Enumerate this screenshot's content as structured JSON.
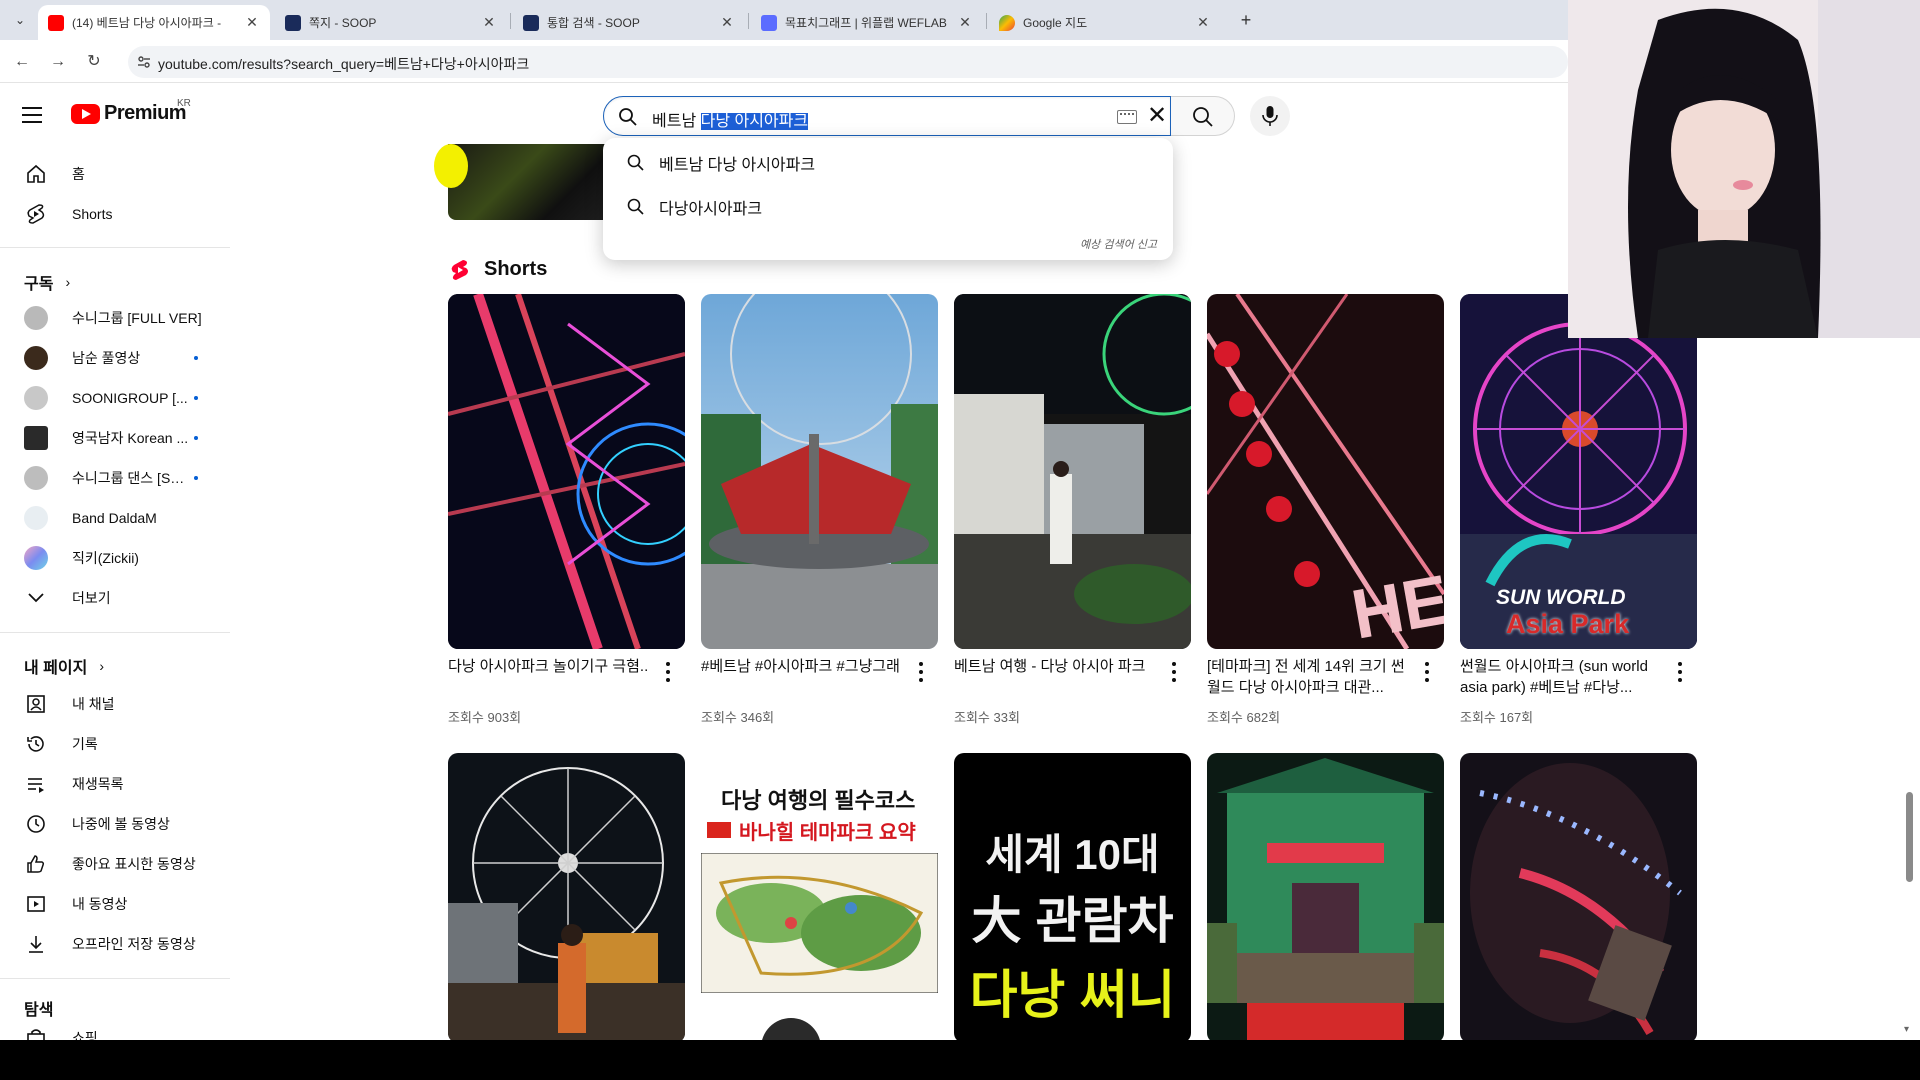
{
  "browser": {
    "tabs": [
      {
        "title": "(14) 베트남 다낭 아시아파크 -",
        "favicon_color": "#ff0000",
        "active": true
      },
      {
        "title": "쪽지 - SOOP",
        "favicon_color": "#1a2b5a",
        "active": false
      },
      {
        "title": "통합 검색 - SOOP",
        "favicon_color": "#1a2b5a",
        "active": false
      },
      {
        "title": "목표치그래프 | 위플랩 WEFLAB",
        "favicon_color": "#5b6cff",
        "active": false
      },
      {
        "title": "Google 지도",
        "favicon_color": "#34a853",
        "active": false
      }
    ],
    "new_tab": "+",
    "url": "youtube.com/results?search_query=베트남+다낭+아시아파크"
  },
  "youtube": {
    "logo_text": "Premium",
    "region": "KR",
    "search": {
      "query_prefix": "베트남 ",
      "query_selected": "다낭 아시아파크",
      "clear": "✕"
    },
    "suggestions": [
      {
        "text": "베트남 다낭 아시아파크"
      },
      {
        "text": "다낭아시아파크"
      }
    ],
    "suggestion_report": "예상 검색어 신고"
  },
  "sidebar": {
    "main": [
      {
        "label": "홈",
        "icon": "home-icon"
      },
      {
        "label": "Shorts",
        "icon": "shorts-icon"
      }
    ],
    "subscriptions_title": "구독",
    "subscriptions": [
      {
        "label": "수니그룹 [FULL VER]",
        "color": "#b9b9b9",
        "new": false
      },
      {
        "label": "남순 풀영상",
        "color": "#3b2a1c",
        "new": true
      },
      {
        "label": "SOONIGROUP [...",
        "color": "#c8c8c8",
        "new": true
      },
      {
        "label": "영국남자 Korean ...",
        "color": "#2a2a2a",
        "new": true
      },
      {
        "label": "수니그룹 댄스 [SO...",
        "color": "#bdbdbd",
        "new": true
      },
      {
        "label": "Band DaldaM",
        "color": "#e8eef2",
        "new": false
      },
      {
        "label": "직키(Zickii)",
        "color": "#7b8cf0",
        "new": false
      }
    ],
    "more": "더보기",
    "mypage_title": "내 페이지",
    "mypage": [
      {
        "label": "내 채널",
        "icon": "channel-icon"
      },
      {
        "label": "기록",
        "icon": "history-icon"
      },
      {
        "label": "재생목록",
        "icon": "playlist-icon"
      },
      {
        "label": "나중에 볼 동영상",
        "icon": "watch-later-icon"
      },
      {
        "label": "좋아요 표시한 동영상",
        "icon": "like-icon"
      },
      {
        "label": "내 동영상",
        "icon": "my-videos-icon"
      },
      {
        "label": "오프라인 저장 동영상",
        "icon": "download-icon"
      }
    ],
    "explore_title": "탐색",
    "explore_partial": "쇼핑"
  },
  "shorts": {
    "title": "Shorts",
    "row1": [
      {
        "title": "다낭 아시아파크 놀이기구 극혐..",
        "views": "조회수 903회"
      },
      {
        "title": "#베트남 #아시아파크 #그냥그래",
        "views": "조회수 346회"
      },
      {
        "title": "베트남 여행 - 다낭 아시아 파크",
        "views": "조회수 33회"
      },
      {
        "title": "[테마파크] 전 세계 14위 크기 썬월드 다낭 아시아파크 대관...",
        "views": "조회수 682회"
      },
      {
        "title": "썬월드 아시아파크 (sun world asia park)   #베트남 #다낭...",
        "views": "조회수 167회"
      }
    ],
    "row2_overlays": {
      "t2_line1": "다낭 여행의 필수코스",
      "t2_line2": "바나힐 테마파크 요약",
      "t3_line1": "세계 10대",
      "t3_line2": "大 관람차",
      "t3_line3": "다낭 써니힐",
      "t5_logo1": "SUN WORLD",
      "t5_logo2": "Asia Park"
    }
  }
}
